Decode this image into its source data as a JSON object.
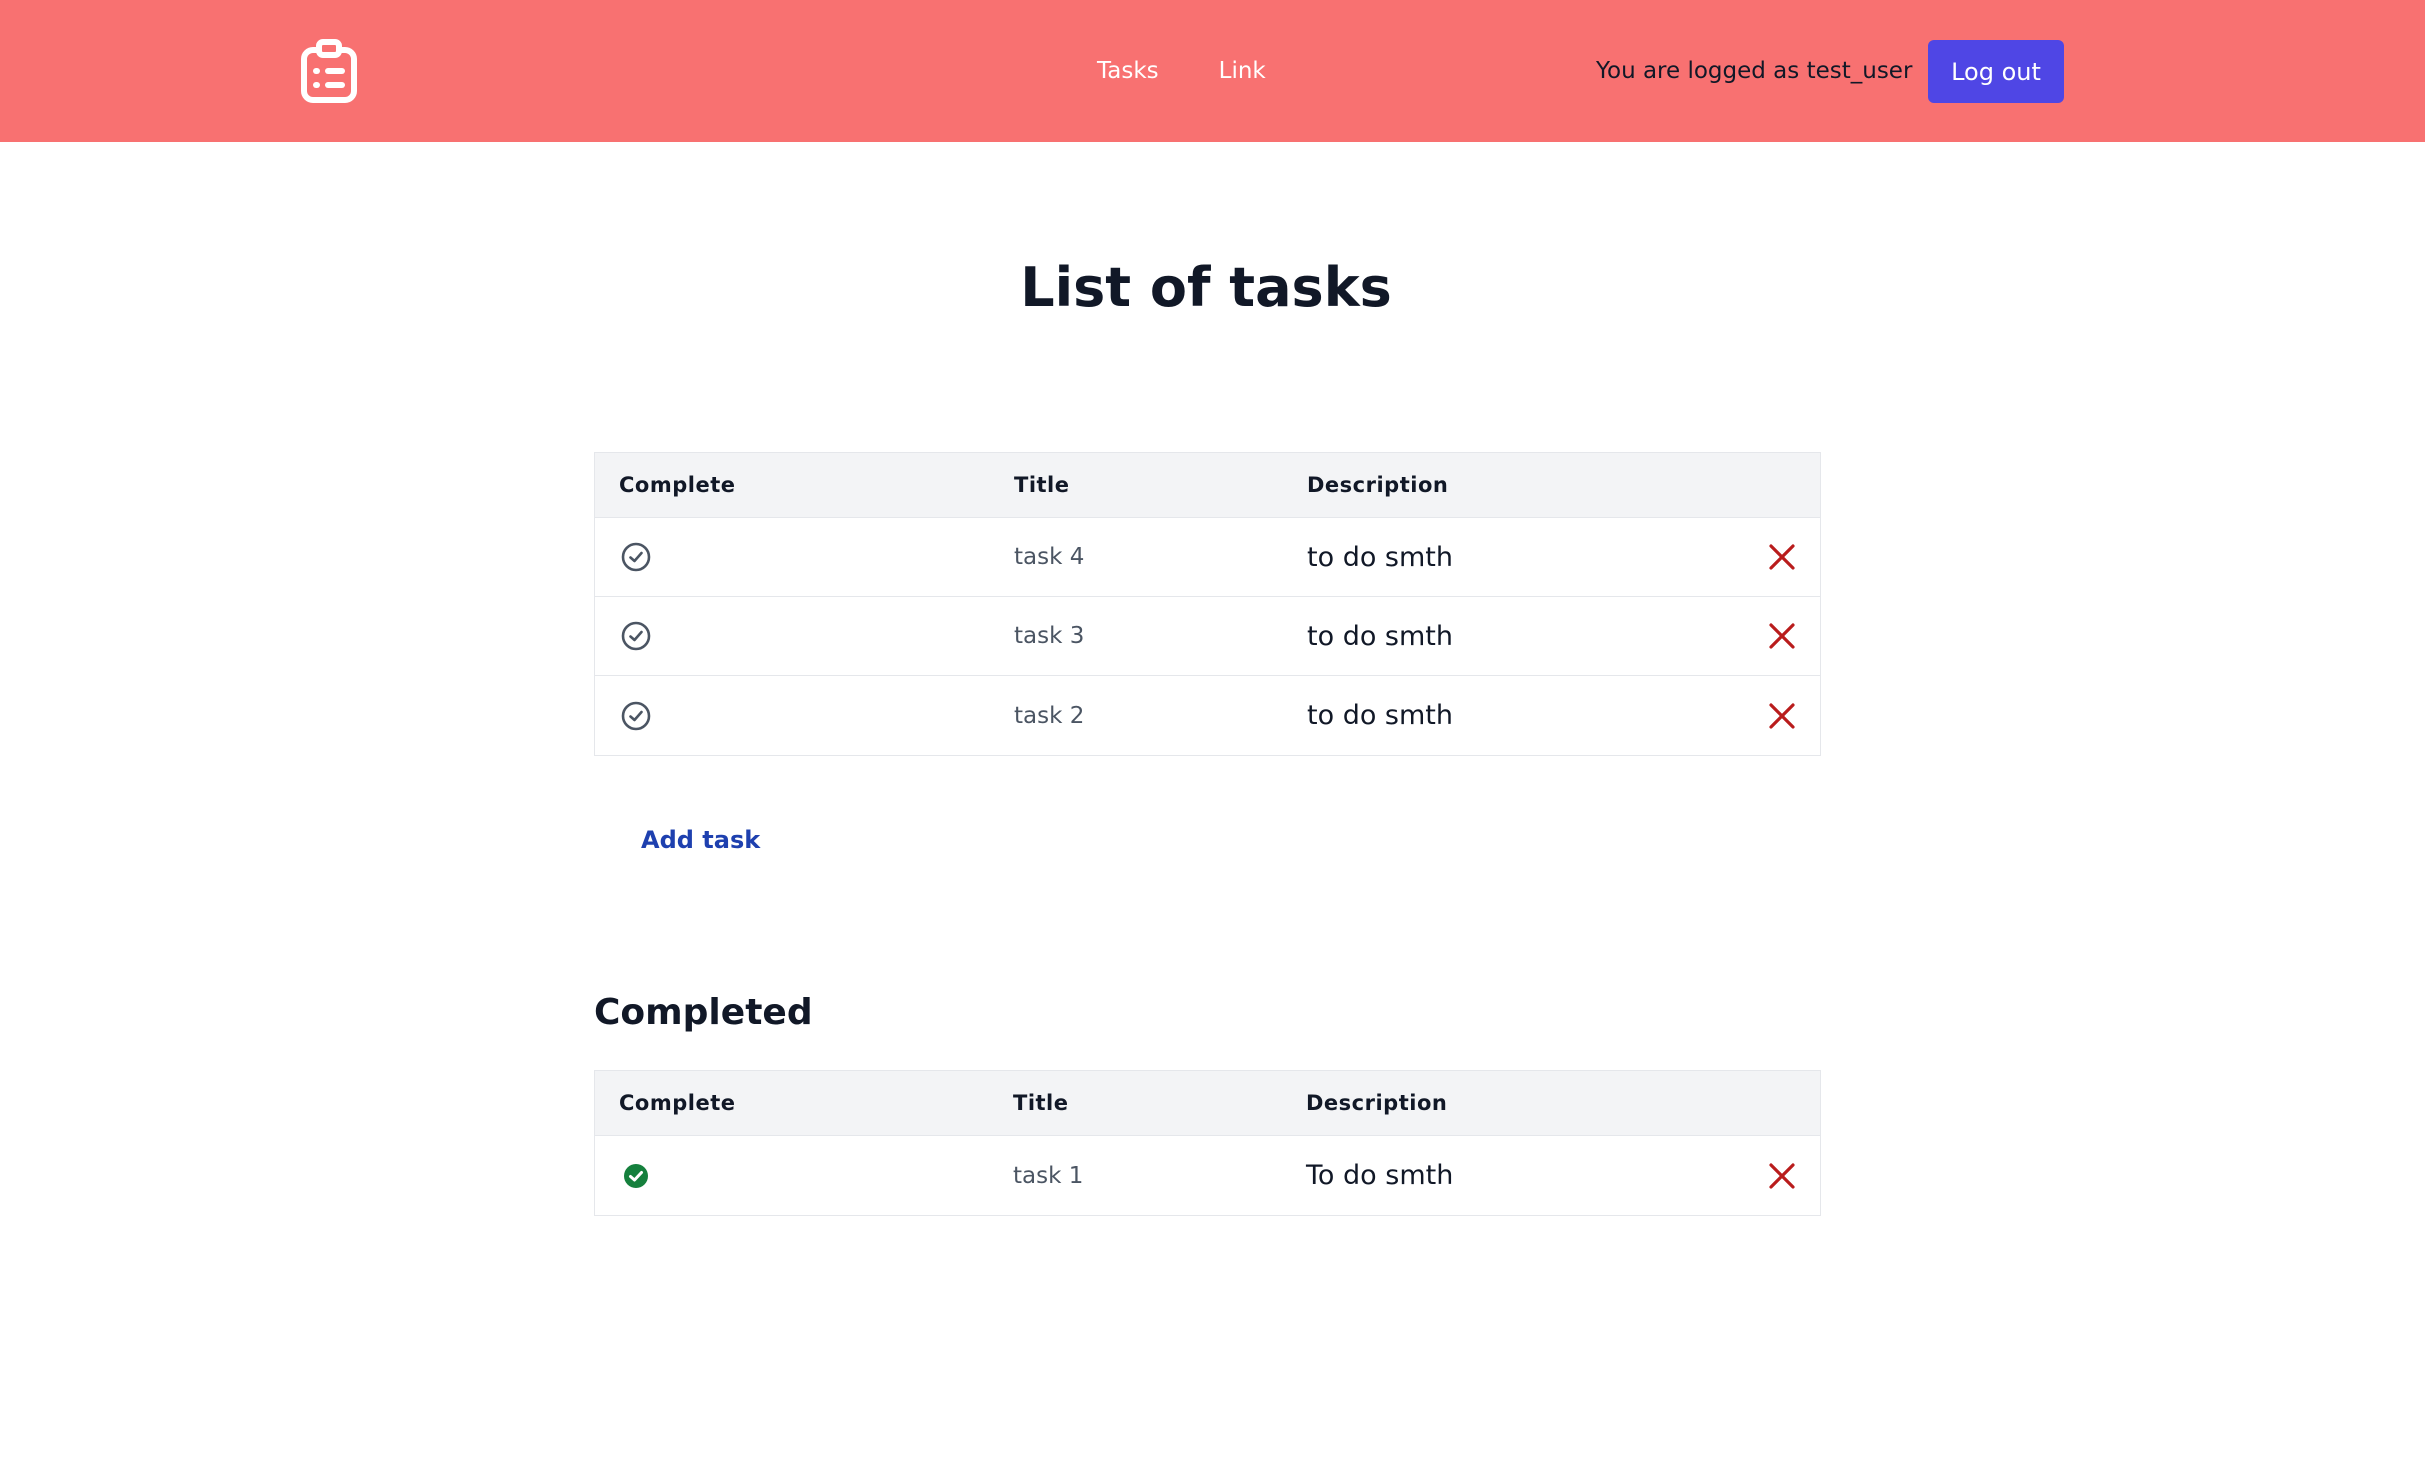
{
  "nav": {
    "logo_icon": "clipboard-list-icon",
    "links": [
      {
        "label": "Tasks"
      },
      {
        "label": "Link"
      }
    ],
    "login_text": "You are logged as test_user",
    "logout_label": "Log out"
  },
  "page": {
    "title": "List of tasks"
  },
  "colors": {
    "navbar": "#f87171",
    "button": "#4f46e5",
    "delete": "#b91c1c",
    "done": "#15803d"
  },
  "tasks": {
    "headers": {
      "complete": "Complete",
      "title": "Title",
      "description": "Description"
    },
    "rows": [
      {
        "title": "task 4",
        "description": "to do smth"
      },
      {
        "title": "task 3",
        "description": "to do smth"
      },
      {
        "title": "task 2",
        "description": "to do smth"
      }
    ],
    "add_label": "Add task"
  },
  "completed": {
    "title": "Completed",
    "headers": {
      "complete": "Complete",
      "title": "Title",
      "description": "Description"
    },
    "rows": [
      {
        "title": "task 1",
        "description": "To do smth"
      }
    ]
  }
}
